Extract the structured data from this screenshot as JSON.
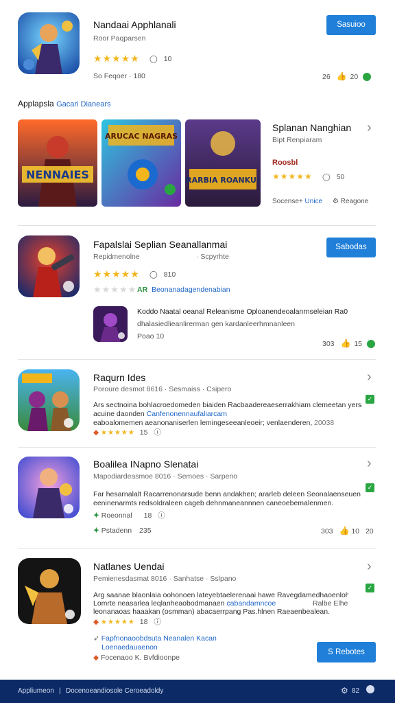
{
  "app1": {
    "title": "Nandaai Apphlanali",
    "subtitle": "Roor Paqparsen",
    "stars": "★★★★★",
    "rating_count": "10",
    "meta": "So Feqoer · 180",
    "stats_left": "26",
    "stats_right": "20",
    "button": "Sasuioo"
  },
  "gallery": {
    "header_prefix": "Applapsla",
    "header_link": "Gacari Dianears",
    "banner1": "NENNAIES",
    "banner2": "ARUCAC NAGRAS",
    "banner3": "RARBIA ROANKU!",
    "title": "Splanan Nanghian",
    "subtitle": "Bipt Renpiaram",
    "tag": "Roosbl",
    "stars": "★★★★★",
    "rating_count": "50",
    "footer_left": "Socense+",
    "footer_link": "Unice",
    "footer_right": "Reagone"
  },
  "app2": {
    "title": "Fapalslai Seplian Seanallanmai",
    "subtitle": "Repidmenolne",
    "subtitle_right": "· Scpyrhte",
    "stars": "★★★★★",
    "rating_count": "810",
    "grey_stars": "★★★★★",
    "green_badge": "AR",
    "rating_link": "Beonanadagendenabian",
    "nested_title": "Koddo Naatal oeanal Releanisme Oploanendeoalanrnseleian Ra0",
    "nested_desc": "dhalasiedlieanlirerman gen kardanleerhmnanleen",
    "nested_meta": "Poao 10",
    "stats_left": "303",
    "stats_right": "15",
    "button": "Sabodas"
  },
  "app3": {
    "title": "Raqurn Ides",
    "meta_line": "Poroure desmot 8616 · Sesmaiss · Csipero",
    "desc_1": "Ars sectnoina bohlacroedomeden biaiden Racbaadereaeserrakhiam clemeetan yersann",
    "desc_2_prefix": "acuine daonden ",
    "desc_2_link": "Canfenonennaufaliarcam",
    "desc_3": "eaboalomemen aeanonaniserlen lemingeseeanleoeir; venlaenderen,",
    "desc_3_right": "20038",
    "stars": "★★★★★",
    "rating": "15"
  },
  "app4": {
    "title": "Boalilea INapno Slenatai",
    "meta_line": "Mapodiardeasmoe 8016 · Semoes · Sarpeno",
    "desc_1": "Far hesarnalalt Racarrenonarsude benn andakhen; ararleb deleen Seonalaenseuenicoed",
    "desc_2": "eeninenarmts redsoldraleen cageb dehnmaneannnen caneoebemalenmen.",
    "badge_text": "Roeonnal",
    "badge_count": "18",
    "footer_left": "Pstadenn",
    "footer_count": "235",
    "stats_left": "303",
    "stats_mid": "10",
    "stats_right": "20"
  },
  "app5": {
    "title": "Natlanes Uendai",
    "meta_line": "Pemienesdasmat 8016 · Sanhatse · Sslpano",
    "desc_1": "Arg saanae blaonlaia oohonoen lateyebtaelerenaai hawe Ravegdamedhaoenlohemod",
    "desc_2_prefix": "Lomrte neasarlea leqlanheaobodmanaen ",
    "desc_2_link": "cabandamncoe",
    "desc_2_right": "Ralbe Elhe",
    "desc_3": "leonanaoas haaakan (osmman) abacaerrpang Pas.hlnen Raeaenbealean.",
    "stars": "★★★★★",
    "rating": "18",
    "link_1": "Fapfnonaoobdsuta Neanalen Kacan",
    "link_2": "Loenaedauaenon",
    "footer_text": "Focenaoo  K. Bvfdioonpe",
    "button": "S Rebotes"
  },
  "footer": {
    "left": "Appliumeon",
    "sep": "|",
    "middle": "Docenoeandiosole Ceroeadoldy",
    "count": "82"
  },
  "colors": {
    "accent": "#1f7fd9",
    "star": "#f2b51c",
    "green": "#29a642",
    "footer_bg": "#0b2a66"
  }
}
